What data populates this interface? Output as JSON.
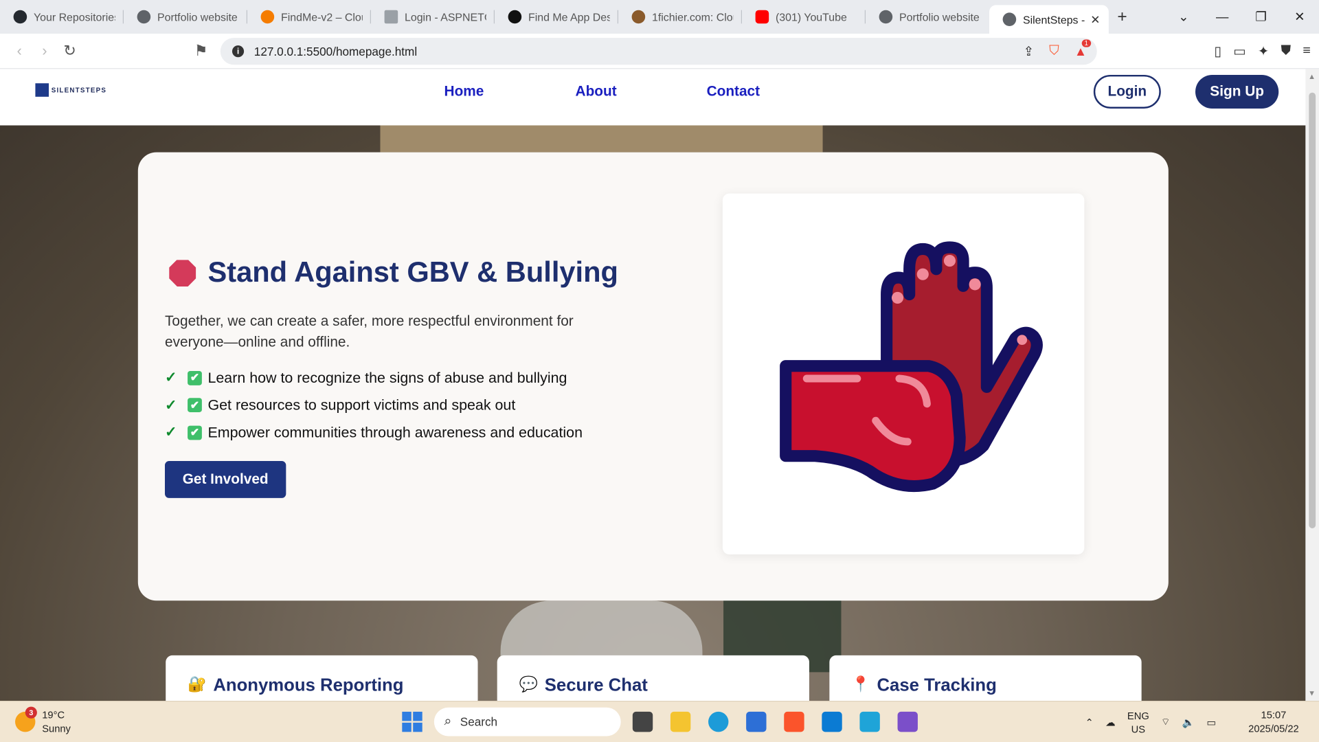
{
  "browser": {
    "tabs": [
      {
        "label": "Your Repositories",
        "icon": "github-icon",
        "color": "#24292f"
      },
      {
        "label": "Portfolio website (",
        "icon": "globe-icon",
        "color": "#5f6368"
      },
      {
        "label": "FindMe-v2 – Clou",
        "icon": "firebase-icon",
        "color": "#f57c00"
      },
      {
        "label": "Login - ASPNETCc",
        "icon": "page-icon",
        "color": "#9aa0a6"
      },
      {
        "label": "Find Me App Des",
        "icon": "openai-icon",
        "color": "#111111"
      },
      {
        "label": "1fichier.com: Clou",
        "icon": "bird-icon",
        "color": "#8a5a2b"
      },
      {
        "label": "(301) YouTube",
        "icon": "youtube-icon",
        "color": "#ff0000"
      },
      {
        "label": "Portfolio website",
        "icon": "globe-icon",
        "color": "#5f6368"
      }
    ],
    "active_tab": {
      "label": "SilentSteps -",
      "close": "✕"
    },
    "new_tab": "+",
    "window_controls": {
      "minimize": "—",
      "restore": "❐",
      "close": "✕"
    },
    "url": "127.0.0.1:5500/homepage.html",
    "shield_badge": "1"
  },
  "site": {
    "logo_text": "SILENTSTEPS",
    "nav": {
      "home": "Home",
      "about": "About",
      "contact": "Contact"
    },
    "login": "Login",
    "signup": "Sign Up"
  },
  "hero": {
    "title": "Stand Against GBV & Bullying",
    "description": "Together, we can create a safer, more respectful environment for everyone—online and offline.",
    "bullets": [
      {
        "check": "✓",
        "text": "Learn how to recognize the signs of abuse and bullying"
      },
      {
        "check": "✓",
        "text": "Get resources to support victims and speak out"
      },
      {
        "check": "✓",
        "text": "Empower communities through awareness and education"
      }
    ],
    "cta": "Get Involved",
    "illustration": "stop-hands-icon",
    "colors": {
      "primary": "#1e2f6e",
      "accent": "#d43a5a",
      "hand_red": "#c8102e"
    }
  },
  "features": [
    {
      "icon": "🔐",
      "label": "Anonymous Reporting"
    },
    {
      "icon": "💬",
      "label": "Secure Chat"
    },
    {
      "icon": "📍",
      "label": "Case Tracking"
    }
  ],
  "taskbar": {
    "weather": {
      "temp": "19°C",
      "condition": "Sunny",
      "badge": "3"
    },
    "search_placeholder": "Search",
    "lang": {
      "l1": "ENG",
      "l2": "US"
    },
    "time": "15:07",
    "date": "2025/05/22"
  }
}
